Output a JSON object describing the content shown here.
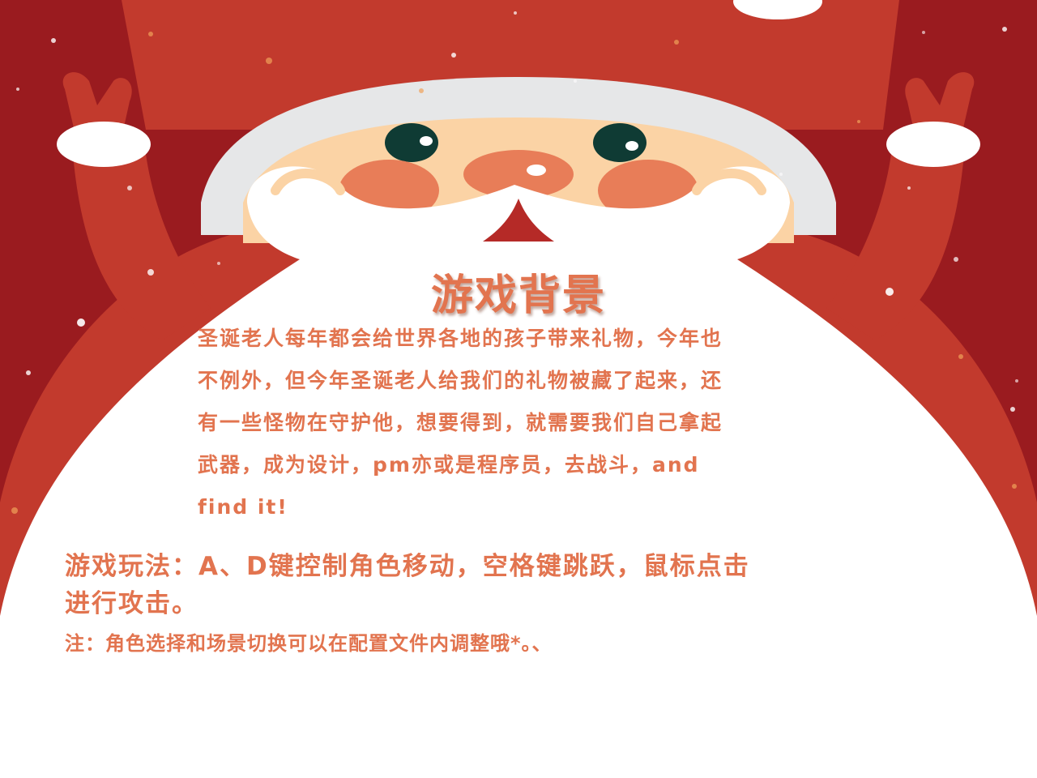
{
  "colors": {
    "background": "#9a1b1f",
    "santa_red": "#c23a2d",
    "beard_white": "#ffffff",
    "hat_trim": "#e6e7e8",
    "skin": "#fbd3a5",
    "cheek": "#e87d58",
    "text": "#e2744f",
    "eye": "#0f3b34"
  },
  "background_art": {
    "icon": "santa-claus-illustration",
    "snow_icon": "snow-sparkle-icon"
  },
  "title": "游戏背景",
  "story": {
    "lines": [
      "圣诞老人每年都会给世界各地的孩子带来礼物，今年也",
      "不例外，但今年圣诞老人给我们的礼物被藏了起来，还",
      "有一些怪物在守护他，想要得到，就需要我们自己拿起",
      "武器，成为设计，pm亦或是程序员，去战斗，and",
      "find it!"
    ]
  },
  "howto": {
    "lines": [
      "游戏玩法：A、D键控制角色移动，空格键跳跃，鼠标点击",
      "进行攻击。"
    ]
  },
  "note": "注：角色选择和场景切换可以在配置文件内调整哦*。、"
}
